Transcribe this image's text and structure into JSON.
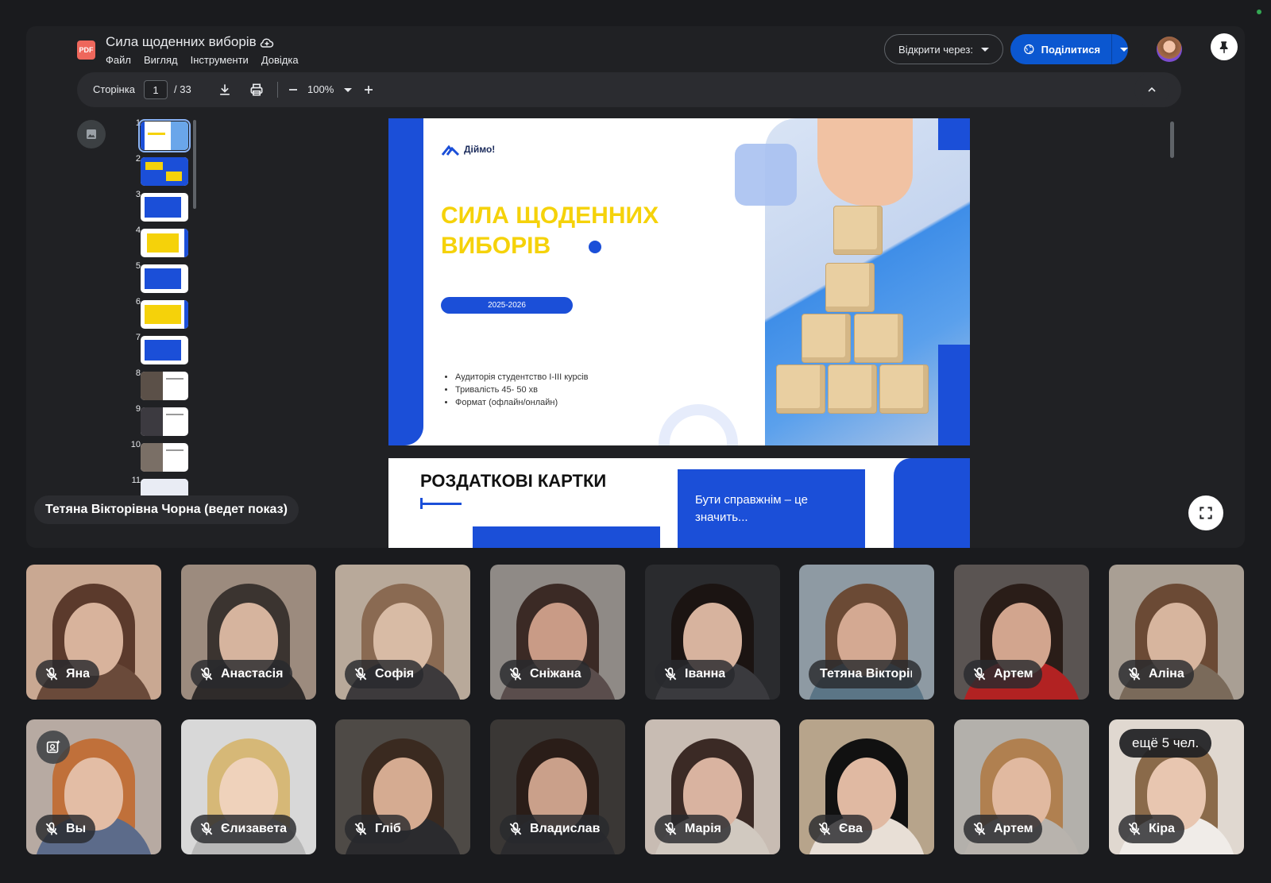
{
  "document": {
    "title": "Сила щоденних виборів",
    "badge": "PDF",
    "menu": [
      "Файл",
      "Вигляд",
      "Інструменти",
      "Довідка"
    ],
    "open_with": "Відкрити через:",
    "share": "Поділитися"
  },
  "toolbar": {
    "page_label": "Сторінка",
    "page_current": "1",
    "page_total": "/ 33",
    "zoom": "100%"
  },
  "thumbnails": [
    "1",
    "2",
    "3",
    "4",
    "5",
    "6",
    "7",
    "8",
    "9",
    "10",
    "11"
  ],
  "slide1": {
    "logo": "Діймо!",
    "title_line1": "СИЛА ЩОДЕННИХ",
    "title_line2": "ВИБОРІВ",
    "pill": "2025-2026",
    "bullets": [
      "Аудиторія студентство І-ІІІ курсів",
      "Тривалість 45- 50 хв",
      "Формат (офлайн/онлайн)"
    ]
  },
  "slide2": {
    "title": "РОЗДАТКОВІ КАРТКИ",
    "box_text": "Бути справжнім – це значить..."
  },
  "presenter": "Тетяна Вікторівна Чорна (ведет показ)",
  "participants_row1": [
    "Яна",
    "Анастасія",
    "Софія",
    "Сніжана",
    "Іванна",
    "Тетяна Вікторівна Чорна",
    "Артем",
    "Аліна"
  ],
  "participants_row2": [
    "Вы",
    "Єлизавета",
    "Гліб",
    "Владислав",
    "Марія",
    "Єва",
    "Артем",
    "Кіра"
  ],
  "more_participants": "ещё 5 чел.",
  "colors": {
    "accent_blue": "#1b4fd8",
    "accent_yellow": "#f5d20a",
    "share_blue": "#0b57d0"
  }
}
